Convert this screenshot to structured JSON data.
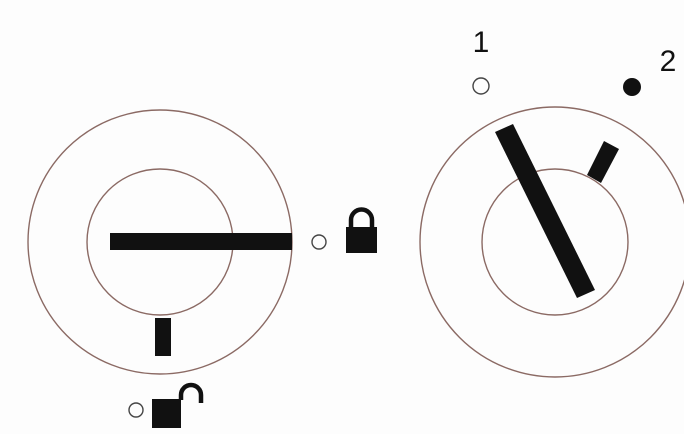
{
  "diagram": {
    "left_switch": {
      "states": [
        "locked",
        "unlocked"
      ],
      "locked_icon": "padlock-closed-icon",
      "unlocked_icon": "padlock-open-icon"
    },
    "right_switch": {
      "positions": [
        {
          "label": "1",
          "indicator": "hollow-circle"
        },
        {
          "label": "2",
          "indicator": "filled-circle"
        }
      ]
    },
    "colors": {
      "ring_stroke": "#8b6a64",
      "ink": "#111111",
      "background": "#fdfdfd"
    }
  }
}
